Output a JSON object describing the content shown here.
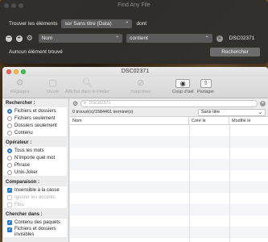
{
  "dark_window": {
    "title": "Find Any File",
    "find_label": "Trouver les éléments",
    "location_select": "sur Sans titre (Data)",
    "suffix": "dont",
    "criterion_field": "Nom",
    "criterion_op": "contient",
    "criterion_value": "DSC02371",
    "status": "Auncun élément trouvé",
    "search_button": "Rechercher"
  },
  "window": {
    "title": "DSC02371"
  },
  "toolbar": {
    "items": [
      {
        "label": "Réglages",
        "icon": "gear-icon"
      },
      {
        "label": "Ouvrir",
        "icon": "open-icon"
      },
      {
        "label": "Afficher dans le Finder",
        "icon": "finder-icon"
      },
      {
        "label": "Supprimer",
        "icon": "delete-icon"
      },
      {
        "label": "Coup d'œil",
        "icon": "eye-icon"
      },
      {
        "label": "Partager",
        "icon": "share-icon"
      }
    ]
  },
  "sidebar": {
    "search_head": "Rechercher :",
    "search_options": [
      "Fichiers et dossiers",
      "Fichiers seulement",
      "Dossiers seulement",
      "Contenu"
    ],
    "operator_head": "Opérateur :",
    "operator_options": [
      "Tous les mots",
      "N'importe quel mot",
      "Phrase",
      "Unix-Joker"
    ],
    "compare_head": "Comparaison :",
    "compare_options": [
      "Insensible à la casse",
      "Ignorer les accents",
      "Flou"
    ],
    "search_in_head": "Chercher dans :",
    "search_in_options": [
      "Contenu des paquets",
      "Fichiers et dossiers invisibles"
    ]
  },
  "results": {
    "search_placeholder": "DSC02371",
    "count": "0 trouvé(s)/1584401 terminé(s)",
    "sort": "Sans titre",
    "columns": [
      "Nom",
      "Créé le",
      "Modifié le"
    ]
  }
}
